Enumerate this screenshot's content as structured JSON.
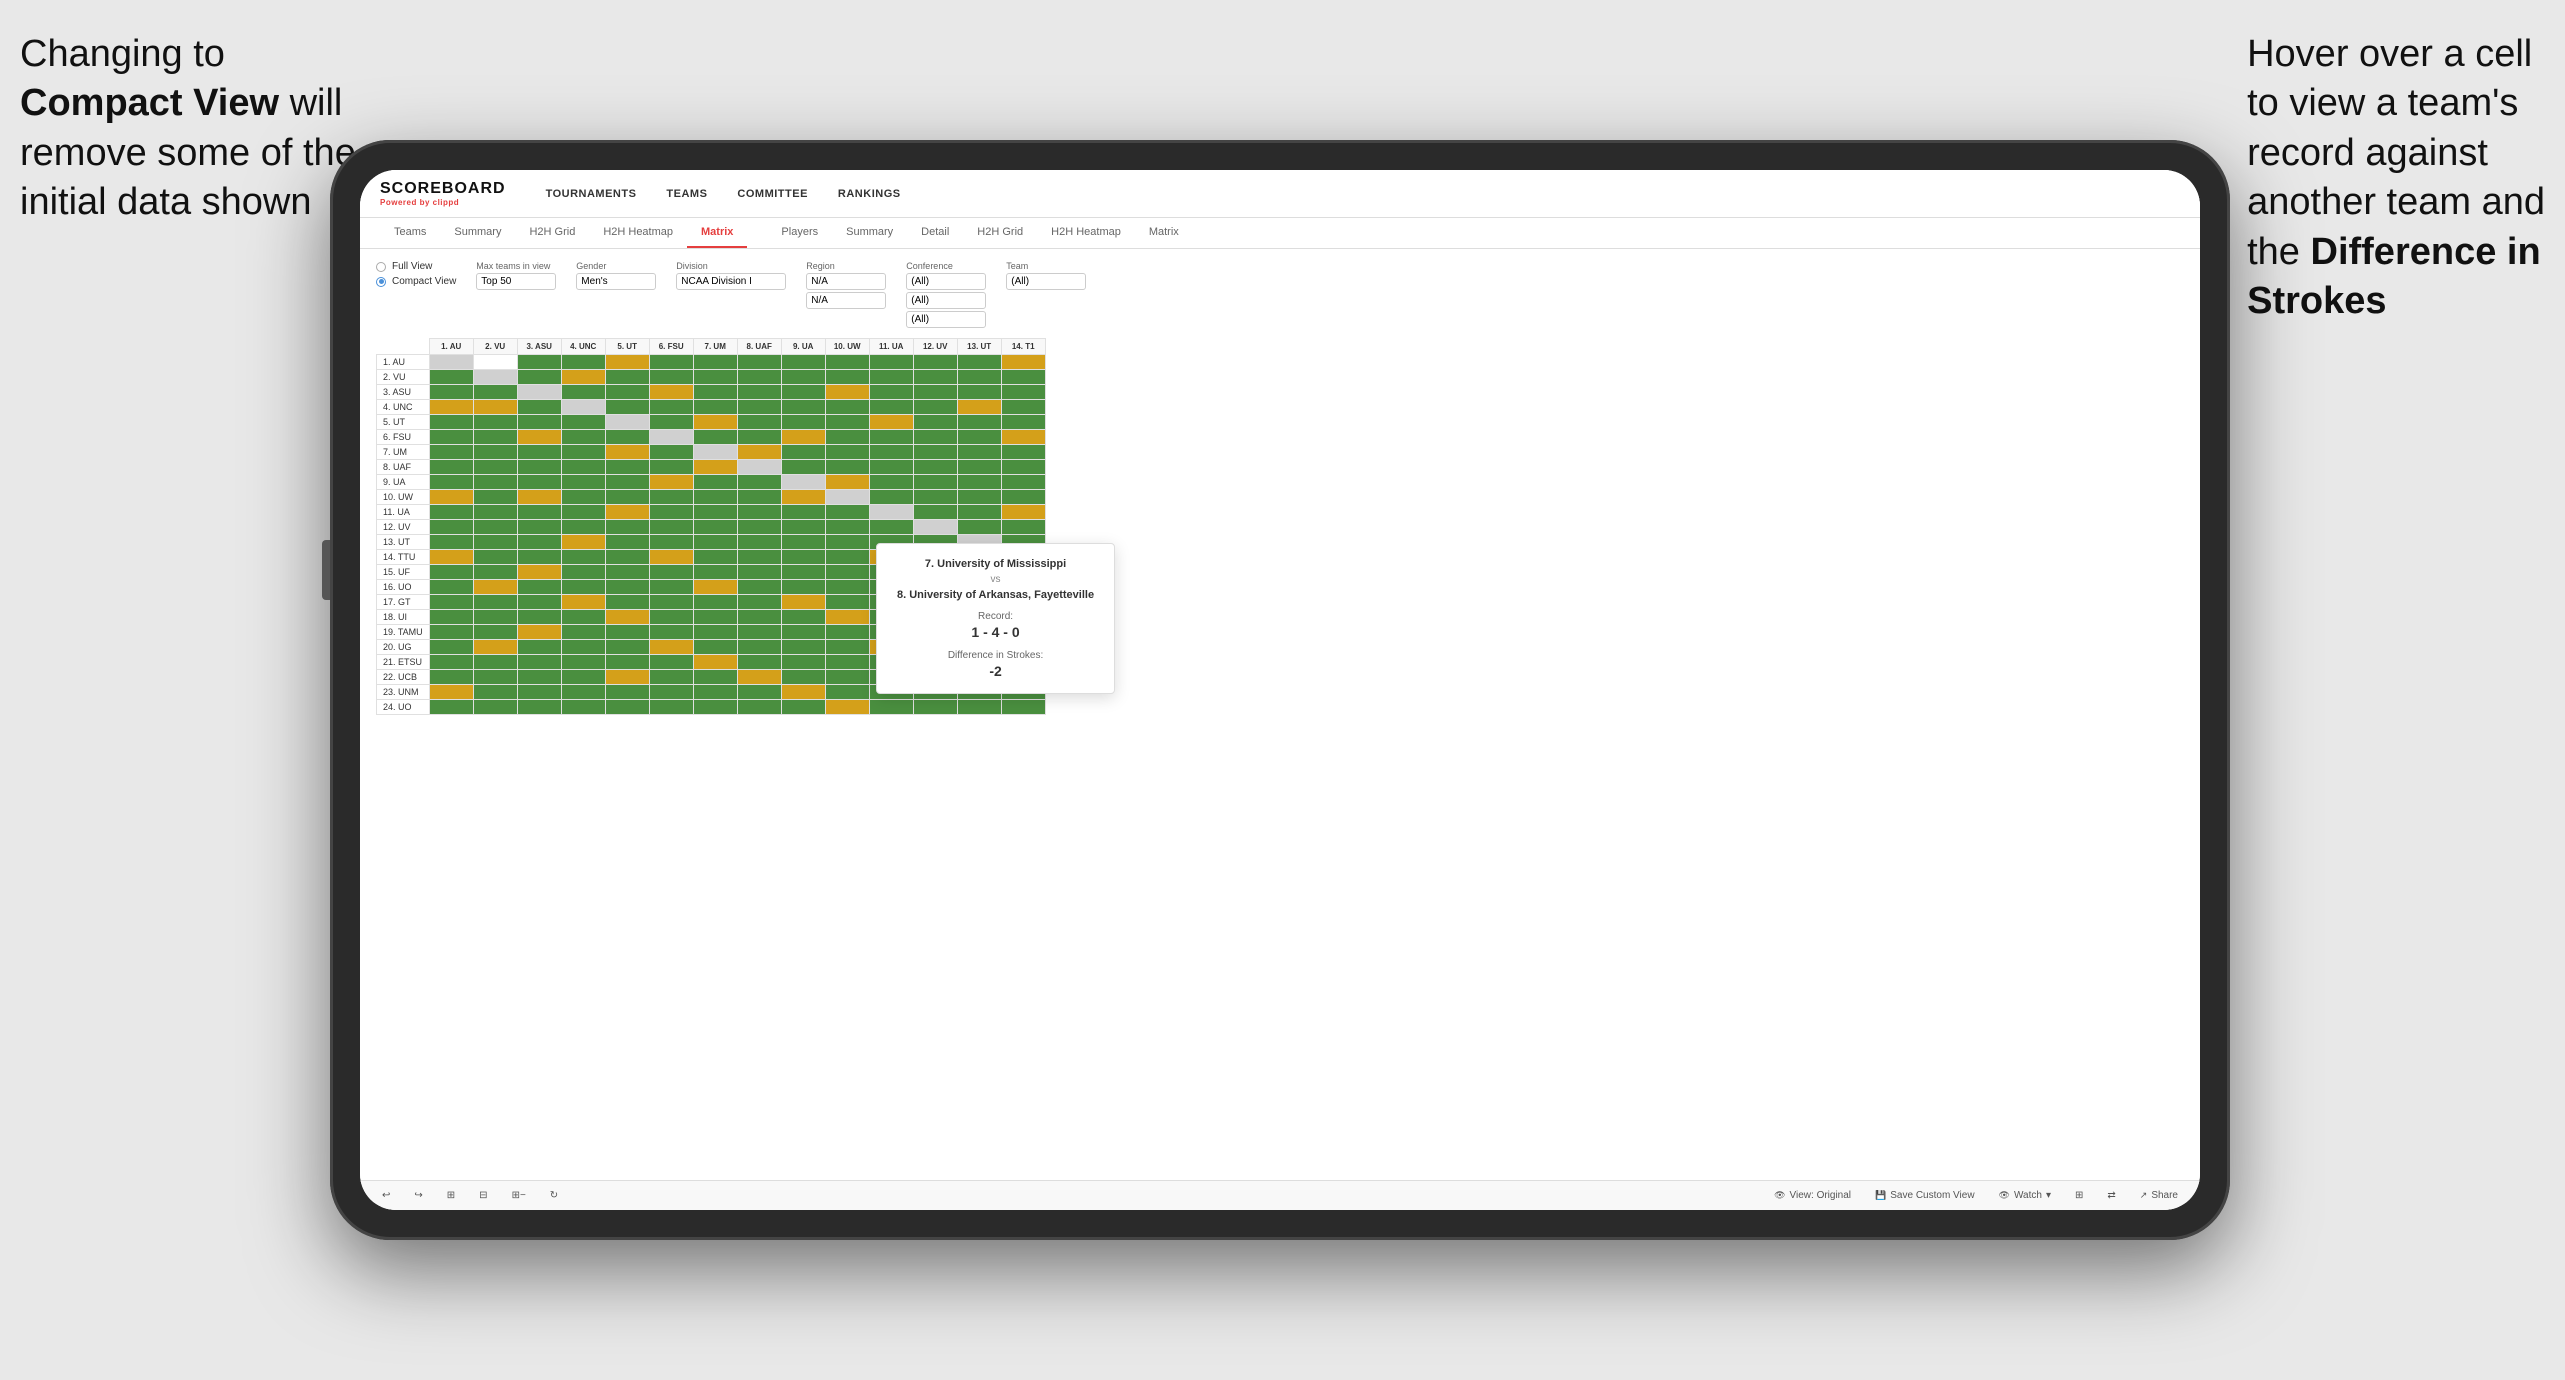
{
  "page": {
    "bg_color": "#e8e8e8"
  },
  "annotation_left": {
    "line1": "Changing to",
    "line2_bold": "Compact View",
    "line2_rest": " will",
    "line3": "remove some of the",
    "line4": "initial data shown"
  },
  "annotation_right": {
    "line1": "Hover over a cell",
    "line2": "to view a team's",
    "line3": "record against",
    "line4": "another team and",
    "line5_pre": "the ",
    "line5_bold": "Difference in",
    "line6_bold": "Strokes"
  },
  "app": {
    "logo": {
      "title": "SCOREBOARD",
      "subtitle_pre": "Powered by ",
      "subtitle_brand": "clippd"
    },
    "nav": {
      "items": [
        "TOURNAMENTS",
        "TEAMS",
        "COMMITTEE",
        "RANKINGS"
      ]
    },
    "sub_nav": {
      "groups": [
        {
          "tabs": [
            "Teams",
            "Summary",
            "H2H Grid",
            "H2H Heatmap",
            "Matrix"
          ],
          "active": "Matrix"
        },
        {
          "tabs": [
            "Players",
            "Summary",
            "Detail",
            "H2H Grid",
            "H2H Heatmap",
            "Matrix"
          ]
        }
      ]
    },
    "view_options": {
      "full_view": "Full View",
      "compact_view": "Compact View",
      "selected": "compact"
    },
    "filters": {
      "max_teams": {
        "label": "Max teams in view",
        "value": "Top 50"
      },
      "gender": {
        "label": "Gender",
        "value": "Men's"
      },
      "division": {
        "label": "Division",
        "value": "NCAA Division I"
      },
      "region": {
        "label": "Region",
        "value": "N/A"
      },
      "conference": {
        "label": "Conference",
        "values": [
          "(All)",
          "(All)",
          "(All)"
        ]
      },
      "team": {
        "label": "Team",
        "value": "(All)"
      }
    },
    "matrix": {
      "col_headers": [
        "1. AU",
        "2. VU",
        "3. ASU",
        "4. UNC",
        "5. UT",
        "6. FSU",
        "7. UM",
        "8. UAF",
        "9. UA",
        "10. UW",
        "11. UA",
        "12. UV",
        "13. UT",
        "14. T1"
      ],
      "row_labels": [
        "1. AU",
        "2. VU",
        "3. ASU",
        "4. UNC",
        "5. UT",
        "6. FSU",
        "7. UM",
        "8. UAF",
        "9. UA",
        "10. UW",
        "11. UA",
        "12. UV",
        "13. UT",
        "14. TTU",
        "15. UF",
        "16. UO",
        "17. GT",
        "18. UI",
        "19. TAMU",
        "20. UG",
        "21. ETSU",
        "22. UCB",
        "23. UNM",
        "24. UO"
      ]
    },
    "tooltip": {
      "team1": "7. University of Mississippi",
      "vs": "vs",
      "team2": "8. University of Arkansas, Fayetteville",
      "record_label": "Record:",
      "record_val": "1 - 4 - 0",
      "strokes_label": "Difference in Strokes:",
      "strokes_val": "-2"
    },
    "toolbar": {
      "view_original": "View: Original",
      "save_custom": "Save Custom View",
      "watch": "Watch",
      "share": "Share"
    }
  }
}
